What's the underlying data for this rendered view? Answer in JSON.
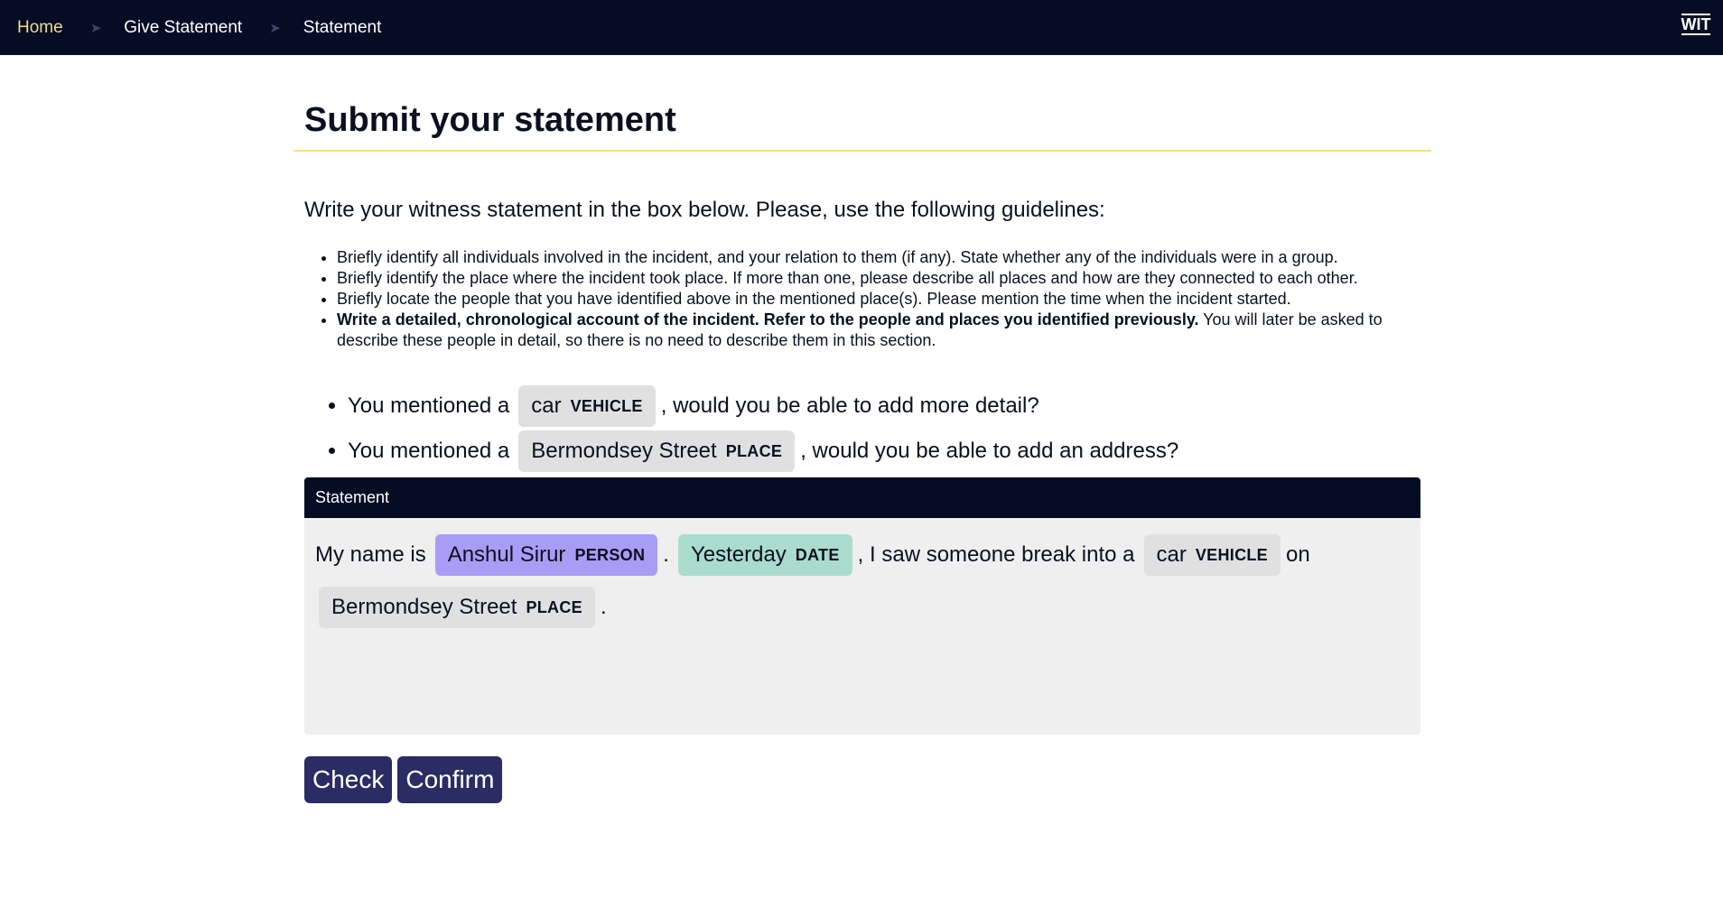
{
  "nav": {
    "breadcrumbs": [
      "Home",
      "Give Statement",
      "Statement"
    ],
    "separator": "➤",
    "logo_text": "WIT"
  },
  "page": {
    "title": "Submit your statement",
    "intro": "Write your witness statement in the box below. Please, use the following guidelines:"
  },
  "guidelines": [
    {
      "bold": "",
      "text": "Briefly identify all individuals involved in the incident, and your relation to them (if any). State whether any of the individuals were in a group."
    },
    {
      "bold": "",
      "text": "Briefly identify the place where the incident took place. If more than one, please describe all places and how are they connected to each other."
    },
    {
      "bold": "",
      "text": "Briefly locate the people that you have identified above in the mentioned place(s). Please mention the time when the incident started."
    },
    {
      "bold": "Write a detailed, chronological account of the incident. Refer to the people and places you identified previously.",
      "text": " You will later be asked to describe these people in detail, so there is no need to describe them in this section."
    }
  ],
  "suggestions": [
    {
      "prefix": "You mentioned a",
      "entity": "car",
      "type": "VEHICLE",
      "suffix": ", would you be able to add more detail?"
    },
    {
      "prefix": "You mentioned a",
      "entity": "Bermondsey Street",
      "type": "PLACE",
      "suffix": ", would you be able to add an address?"
    }
  ],
  "statement": {
    "header": "Statement",
    "line1": {
      "t1": "My name is",
      "person": "Anshul Sirur",
      "person_type": "PERSON",
      "t2": ".",
      "date": "Yesterday",
      "date_type": "DATE",
      "t3": ", I saw someone break into a",
      "vehicle": "car",
      "vehicle_type": "VEHICLE",
      "t4": "on"
    },
    "line2": {
      "place": "Bermondsey Street",
      "place_type": "PLACE",
      "t5": "."
    }
  },
  "actions": {
    "check_label": "Check",
    "confirm_label": "Confirm"
  },
  "colors": {
    "nav_bg": "#050c24",
    "home_link": "#f3dd86",
    "title_rule": "#f0e38a",
    "person_chip": "#a99cf5",
    "date_chip": "#a9dccd",
    "neutral_chip": "#e0e0e0",
    "button": "#2b2c63"
  }
}
